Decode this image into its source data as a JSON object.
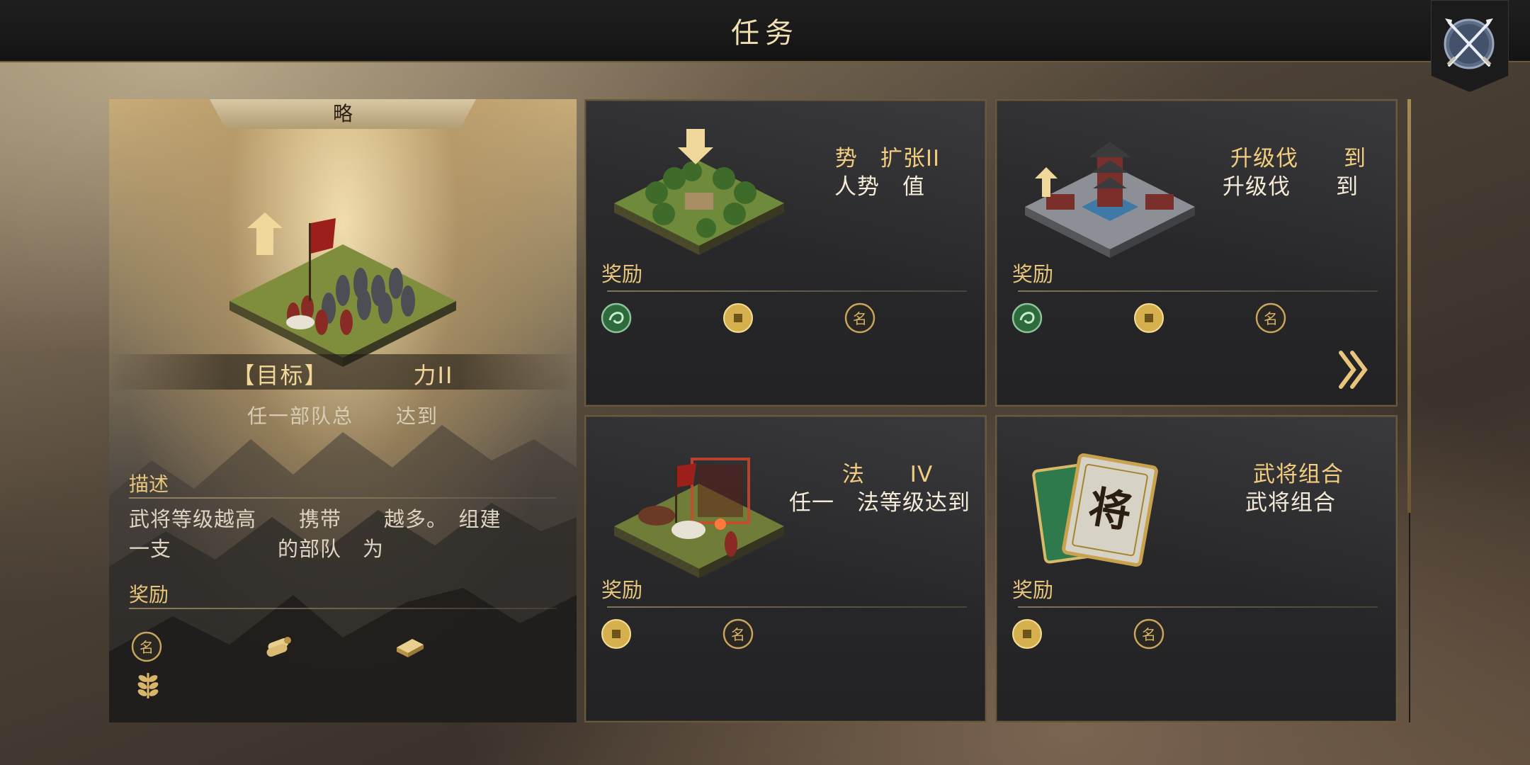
{
  "header": {
    "title": "任务"
  },
  "left_panel": {
    "tab": "略",
    "objective_title": "【目标】　　　　力II",
    "objective_desc": "任一部队总　　达到",
    "description_heading": "描述",
    "description_line1": "武将等级越高　　携带　　越多。　组建",
    "description_line2": "一支　　　　　的部队　为",
    "rewards_heading": "奖励",
    "rewards": [
      "fame-token-icon",
      "timber-icon",
      "iron-ingot-icon",
      "grain-icon"
    ]
  },
  "quests": [
    {
      "title": "势　扩张II",
      "subtitle": "人势　值",
      "rewards_label": "奖励",
      "rewards": [
        "jade-token-icon",
        "copper-coin-icon",
        "fame-token-icon"
      ]
    },
    {
      "title": "升级伐　　到",
      "subtitle": "升级伐　　到",
      "rewards_label": "奖励",
      "rewards": [
        "jade-token-icon",
        "copper-coin-icon",
        "fame-token-icon"
      ]
    },
    {
      "title": "法　　IV",
      "subtitle": "任一　法等级达到",
      "rewards_label": "奖励",
      "rewards": [
        "copper-coin-icon",
        "fame-token-icon"
      ]
    },
    {
      "title": "武将组合",
      "subtitle": "武将组合",
      "rewards_label": "奖励",
      "rewards": [
        "copper-coin-icon",
        "fame-token-icon"
      ],
      "illus_char": "将"
    }
  ],
  "colors": {
    "accent_gold": "#e8c57c",
    "card_border": "#6b5a39",
    "bar": "#1a1a1b"
  }
}
